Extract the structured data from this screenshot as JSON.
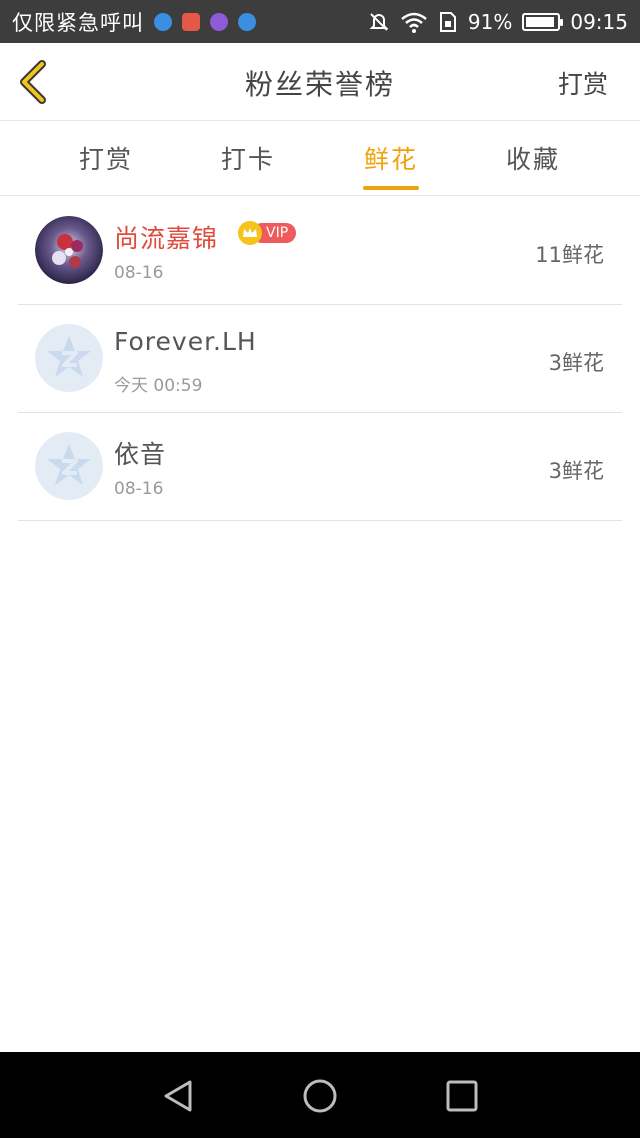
{
  "status_bar": {
    "carrier": "仅限紧急呼叫",
    "battery_text": "91%",
    "battery_level": 0.91,
    "clock": "09:15",
    "app_icons": [
      "qq-icon",
      "mail-icon",
      "purple-app-icon",
      "qq-icon"
    ]
  },
  "header": {
    "title": "粉丝荣誉榜",
    "action": "打赏"
  },
  "tabs": [
    {
      "label": "打赏"
    },
    {
      "label": "打卡"
    },
    {
      "label": "鲜花"
    },
    {
      "label": "收藏"
    }
  ],
  "active_tab": "鲜花",
  "fans": [
    {
      "name": "尚流嘉锦",
      "vip": true,
      "vip_label": "VIP",
      "time": "08-16",
      "amount": "11鲜花",
      "avatar": "photo"
    },
    {
      "name": "Forever.LH",
      "vip": false,
      "time": "今天 00:59",
      "amount": "3鲜花",
      "avatar": "default"
    },
    {
      "name": "依音",
      "vip": false,
      "time": "08-16",
      "amount": "3鲜花",
      "avatar": "default"
    }
  ],
  "colors": {
    "accent": "#f0a30a",
    "vip_name": "#e24a3b",
    "status_bar": "#3d3d3d"
  }
}
